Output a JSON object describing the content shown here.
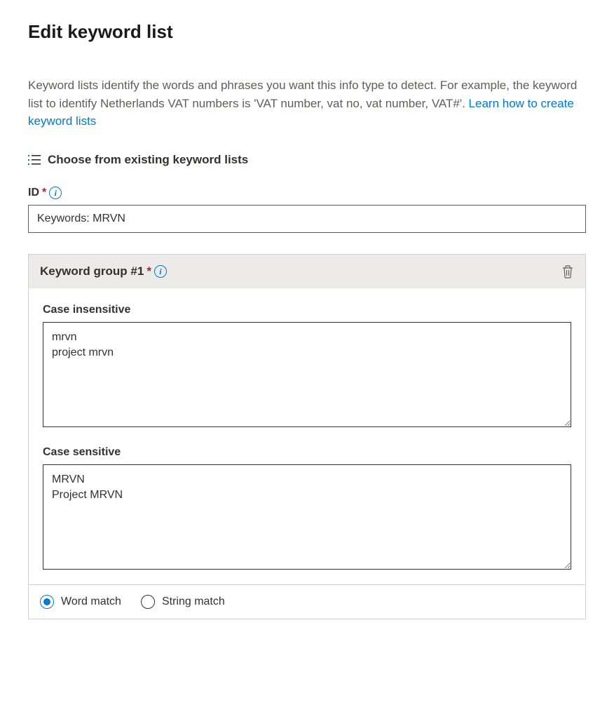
{
  "title": "Edit keyword list",
  "description_text": "Keyword lists identify the words and phrases you want this info type to detect. For example, the keyword list to identify Netherlands VAT numbers is 'VAT number, vat no, vat number, VAT#'. ",
  "description_link": "Learn how to create keyword lists",
  "choose_existing_label": "Choose from existing keyword lists",
  "id_label": "ID",
  "id_value": "Keywords: MRVN",
  "group": {
    "header": "Keyword group #1",
    "case_insensitive_label": "Case insensitive",
    "case_insensitive_value": "mrvn\nproject mrvn",
    "case_sensitive_label": "Case sensitive",
    "case_sensitive_value": "MRVN\nProject MRVN"
  },
  "match_options": {
    "word": "Word match",
    "string": "String match",
    "selected": "word"
  }
}
